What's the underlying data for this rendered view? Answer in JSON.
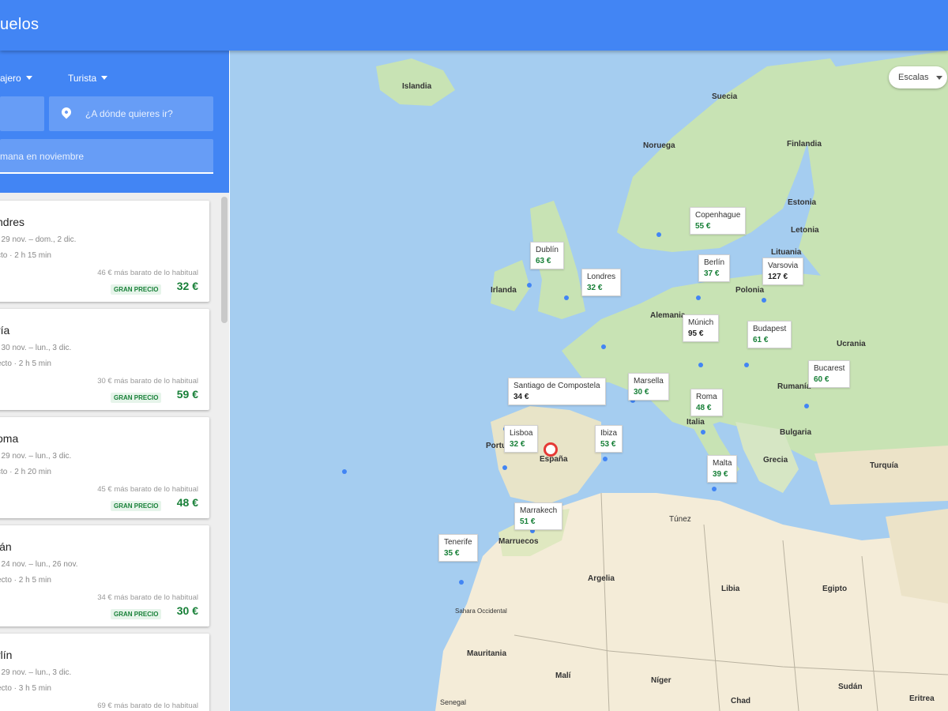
{
  "app": {
    "title": "uelos"
  },
  "search": {
    "passengers": "ajero",
    "cabin": "Turista",
    "origin_placeholder": "",
    "destination_placeholder": "¿A dónde quieres ir?",
    "dates": "mana en noviembre"
  },
  "results": [
    {
      "city": "ndres",
      "dates": ", 29 nov. – dom., 2 dic.",
      "duration": "cto · 2 h 15 min",
      "cheaper": "46 € más barato de lo habitual",
      "badge": "GRAN PRECIO",
      "price": "32 €"
    },
    {
      "city": "ría",
      "dates": ", 30 nov. – lun., 3 dic.",
      "duration": "ecto · 2 h 5 min",
      "cheaper": "30 € más barato de lo habitual",
      "badge": "GRAN PRECIO",
      "price": "59 €"
    },
    {
      "city": "oma",
      "dates": ", 29 nov. – lun., 3 dic.",
      "duration": "cto · 2 h 20 min",
      "cheaper": "45 € más barato de lo habitual",
      "badge": "GRAN PRECIO",
      "price": "48 €"
    },
    {
      "city": "lán",
      "dates": ", 24 nov. – lun., 26 nov.",
      "duration": "ecto · 2 h 5 min",
      "cheaper": "34 € más barato de lo habitual",
      "badge": "GRAN PRECIO",
      "price": "30 €"
    },
    {
      "city": "rlín",
      "dates": ", 29 nov. – lun., 3 dic.",
      "duration": "ecto · 3 h 5 min",
      "cheaper": "69 € más barato de lo habitual",
      "badge": "",
      "price": ""
    }
  ],
  "map": {
    "stops_filter": "Escalas",
    "country_labels": [
      "Islandia",
      "Suecia",
      "Noruega",
      "Finlandia",
      "Estonia",
      "Letonia",
      "Lituania",
      "Irlanda",
      "Alemania",
      "Polonia",
      "Ucrania",
      "Bulgaria",
      "Grecia",
      "Turquía",
      "Argelia",
      "Libia",
      "Egipto",
      "Mauritania",
      "Malí",
      "Níger",
      "Chad",
      "Sudán",
      "Eritrea",
      "Marruecos",
      "España",
      "Portugal",
      "Rumanía",
      "Italia",
      "Túnez",
      "Sahara Occidental",
      "Senegal"
    ],
    "destinations": [
      {
        "city": "Dublín",
        "price": "63 €"
      },
      {
        "city": "Londres",
        "price": "32 €"
      },
      {
        "city": "Copenhague",
        "price": "55 €"
      },
      {
        "city": "Berlín",
        "price": "37 €"
      },
      {
        "city": "Varsovia",
        "price": "127 €"
      },
      {
        "city": "Múnich",
        "price": "95 €"
      },
      {
        "city": "Budapest",
        "price": "61 €"
      },
      {
        "city": "Bucarest",
        "price": "60 €"
      },
      {
        "city": "Santiago de Compostela",
        "price": "34 €"
      },
      {
        "city": "Marsella",
        "price": "30 €"
      },
      {
        "city": "Roma",
        "price": "48 €"
      },
      {
        "city": "Lisboa",
        "price": "32 €"
      },
      {
        "city": "Ibiza",
        "price": "53 €"
      },
      {
        "city": "Malta",
        "price": "39 €"
      },
      {
        "city": "Marrakech",
        "price": "51 €"
      },
      {
        "city": "Tenerife",
        "price": "35 €"
      }
    ]
  },
  "colors": {
    "brand": "#4285f4",
    "price_green": "#188038",
    "water": "#a5cdf0",
    "land": "#c8e3b4",
    "desert": "#f4ecd8"
  }
}
